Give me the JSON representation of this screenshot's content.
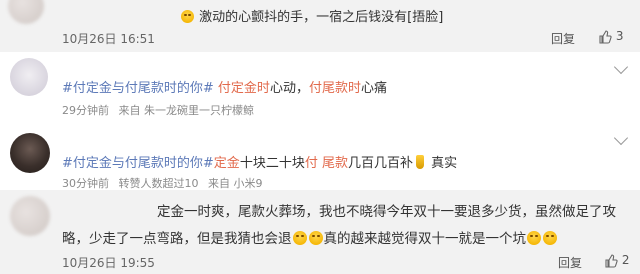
{
  "comment1": {
    "text_prefix": "...",
    "text": "激动的心颤抖的手，一宿之后钱没有",
    "emoji_tag": "[捂脸]",
    "date": "10月26日 16:51",
    "reply_label": "回复",
    "like_count": "3"
  },
  "comment2": {
    "tag1": "#付定金与付尾款时的你#",
    "seg1": " 付定金时",
    "mid1": "心动，",
    "seg2": "付尾款时",
    "mid2": "心痛",
    "time": "29分钟前",
    "source": "来自 朱一龙碗里一只柠檬鲸"
  },
  "comment3": {
    "tag1": "#付定金与付尾款时的你#",
    "seg1": "定金",
    "mid1": "十块二十块",
    "seg2": "付 尾款",
    "mid2": "几百几百补",
    "end": " 真实",
    "time": "30分钟前",
    "reposts": "转赞人数超过10",
    "source": "来自 小米9"
  },
  "comment4": {
    "line1": "定金一时爽，尾款火葬场，我也不晓得今年双十一要退多少货，虽然做足了攻",
    "line2a": "略，少走了一点弯路，但是我猜也会退",
    "line2b": "真的越来越觉得双十一就是一个坑",
    "date": "10月26日 19:55",
    "reply_label": "回复",
    "like_count": "2"
  },
  "colors": {
    "tag": "#5d7ab8",
    "hot": "#e26a4c",
    "gray_bg": "#f2f2f2"
  }
}
